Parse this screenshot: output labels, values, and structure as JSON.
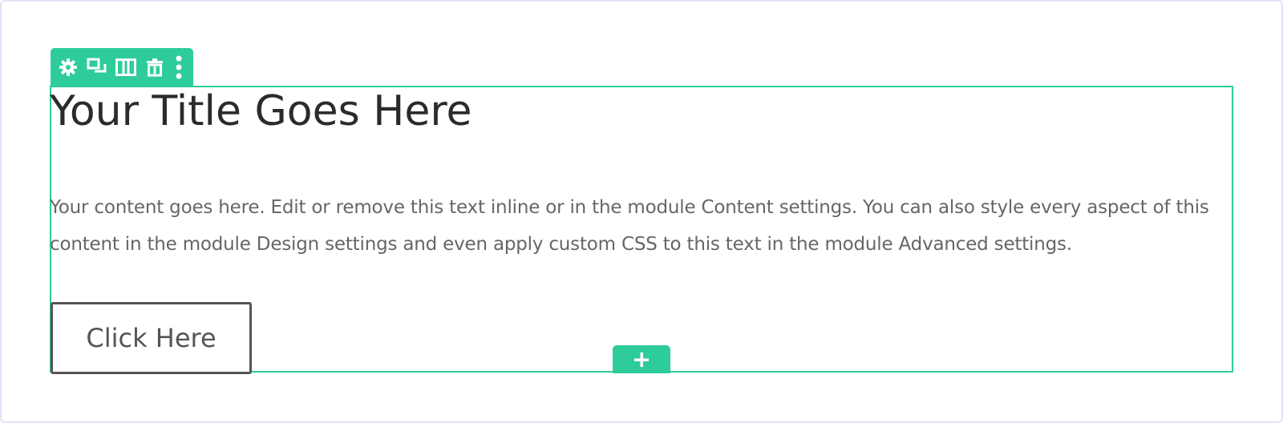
{
  "toolbar": {
    "accent_color": "#2ecc9a",
    "tools": [
      {
        "name": "settings",
        "icon": "gear-icon"
      },
      {
        "name": "duplicate",
        "icon": "duplicate-icon"
      },
      {
        "name": "columns",
        "icon": "columns-icon"
      },
      {
        "name": "delete",
        "icon": "trash-icon"
      },
      {
        "name": "more",
        "icon": "more-vertical-icon"
      }
    ]
  },
  "module": {
    "title": "Your Title Goes Here",
    "body": "Your content goes here. Edit or remove this text inline or in the module Content settings. You can also style every aspect of this content in the module Design settings and even apply custom CSS to this text in the module Advanced settings.",
    "button_label": "Click Here",
    "border_color": "#2ecc9a"
  },
  "add_module": {
    "icon": "plus-icon"
  }
}
